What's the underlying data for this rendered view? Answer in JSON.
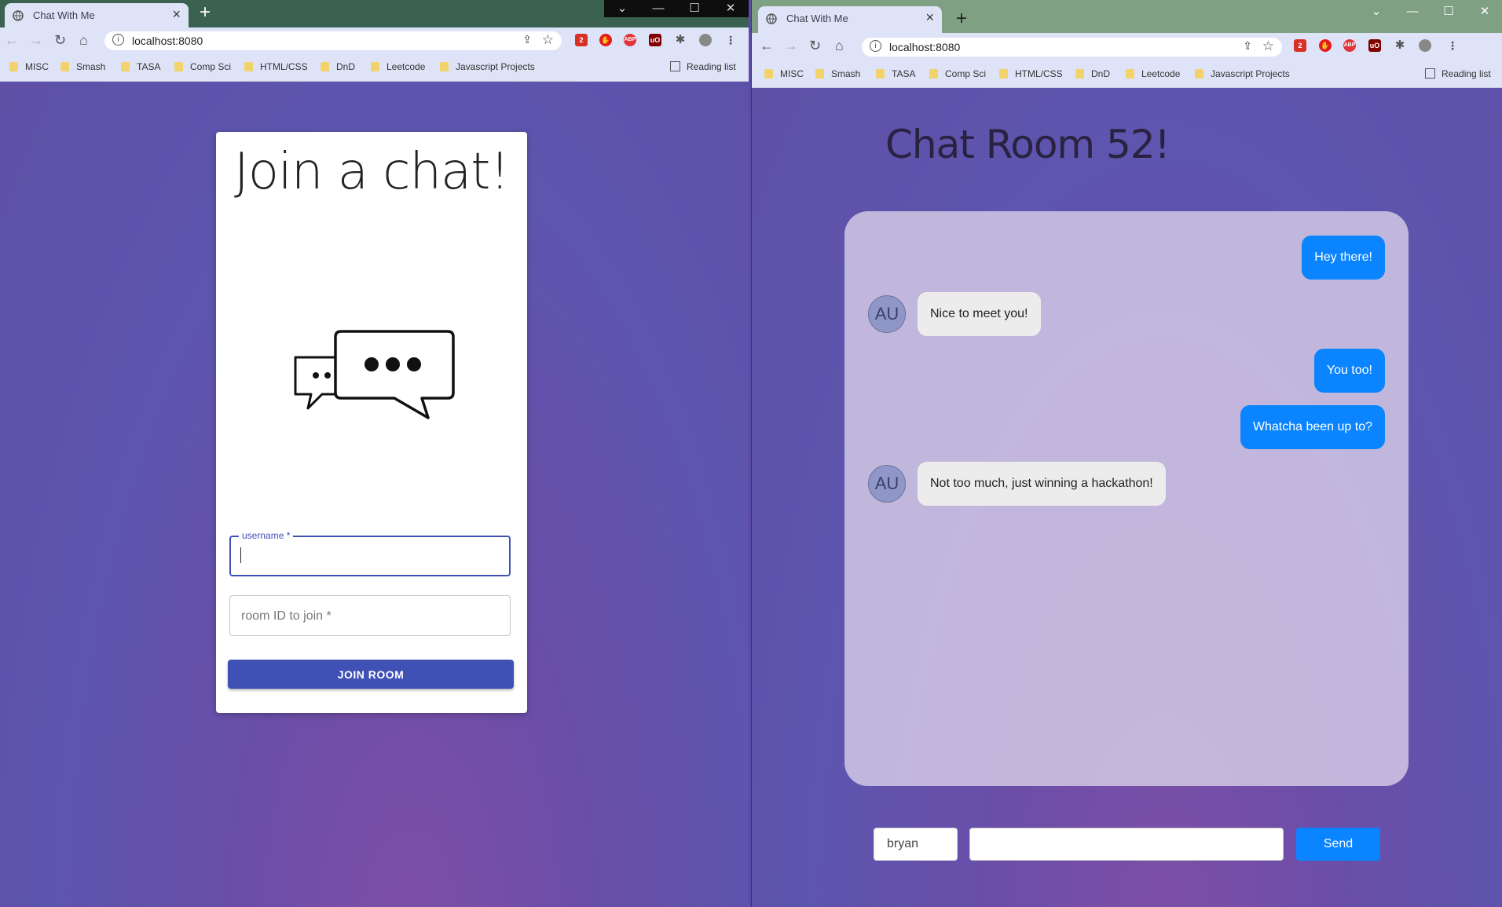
{
  "left_window": {
    "tab_title": "Chat With Me",
    "url": "localhost:8080",
    "bookmarks": [
      "MISC",
      "Smash",
      "TASA",
      "Comp Sci",
      "HTML/CSS",
      "DnD",
      "Leetcode",
      "Javascript Projects"
    ],
    "reading_list": "Reading list",
    "page": {
      "heading": "Join a chat!",
      "username_label": "username *",
      "username_value": "",
      "room_placeholder": "room ID to join *",
      "join_button": "JOIN ROOM"
    }
  },
  "right_window": {
    "tab_title": "Chat With Me",
    "url": "localhost:8080",
    "bookmarks": [
      "MISC",
      "Smash",
      "TASA",
      "Comp Sci",
      "HTML/CSS",
      "DnD",
      "Leetcode",
      "Javascript Projects"
    ],
    "reading_list": "Reading list",
    "page": {
      "room_title": "Chat Room 52!",
      "messages": [
        {
          "sender": "me",
          "text": "Hey there!"
        },
        {
          "sender": "other",
          "avatar": "AU",
          "text": "Nice to meet you!"
        },
        {
          "sender": "me",
          "text": "You too!"
        },
        {
          "sender": "me",
          "text": "Whatcha been up to?"
        },
        {
          "sender": "other",
          "avatar": "AU",
          "text": "Not too much, just winning a hackathon!"
        }
      ],
      "name_value": "bryan",
      "message_value": "",
      "send_button": "Send"
    }
  },
  "extensions": {
    "gmail_badge": "2",
    "abp": "ABP",
    "ublock": "uO"
  },
  "colors": {
    "accent_blue": "#0a84ff",
    "join_button": "#3f51b5",
    "page_bg": "#5f4fa6"
  }
}
